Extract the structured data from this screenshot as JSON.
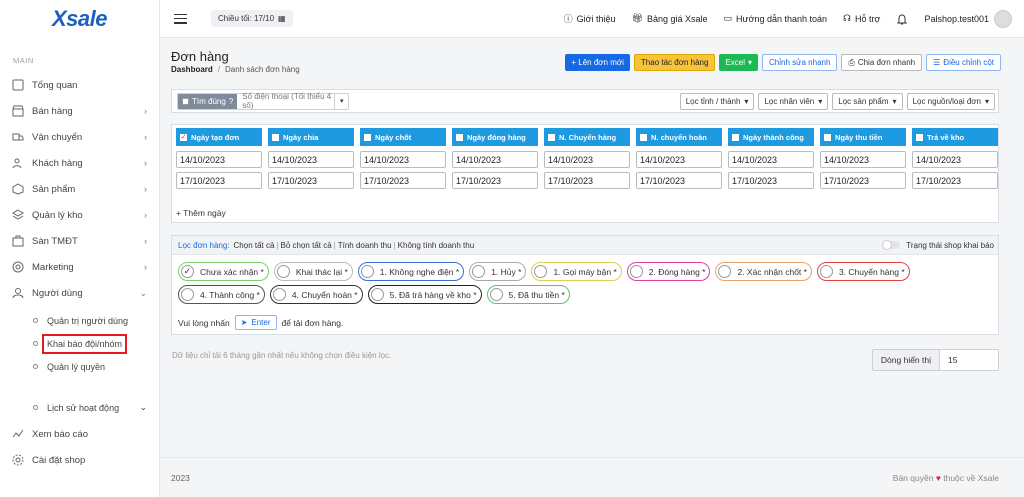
{
  "logo": "Xsale",
  "sidebar": {
    "section": "MAIN",
    "items": [
      {
        "label": "Tổng quan"
      },
      {
        "label": "Bán hàng"
      },
      {
        "label": "Vận chuyển"
      },
      {
        "label": "Khách hàng"
      },
      {
        "label": "Sản phẩm"
      },
      {
        "label": "Quản lý kho"
      },
      {
        "label": "Sàn TMĐT"
      },
      {
        "label": "Marketing"
      },
      {
        "label": "Người dùng"
      }
    ],
    "sub_items": [
      {
        "label": "Quản trị người dùng"
      },
      {
        "label": "Khai báo đội/nhóm"
      },
      {
        "label": "Quản lý quyền"
      }
    ],
    "history": "Lịch sử hoạt động",
    "reports": "Xem báo cáo",
    "shop_settings": "Cài đặt shop"
  },
  "topbar": {
    "cutoff": "Chiều tối: 17/10",
    "links": [
      "Giới thiệu",
      "Bảng giá Xsale",
      "Hướng dẫn thanh toán",
      "Hỗ trợ"
    ],
    "username": "Palshop.test001"
  },
  "page": {
    "title": "Đơn hàng",
    "breadcrumb_root": "Dashboard",
    "breadcrumb_current": "Danh sách đơn hàng"
  },
  "actions": {
    "new_order": "+ Lên đơn mới",
    "order_ops": "Thao tác đơn hàng",
    "excel": "Excel",
    "quick_edit": "Chỉnh sửa nhanh",
    "quick_split": "Chia đơn nhanh",
    "adjust_cols": "Điều chỉnh cột"
  },
  "filter": {
    "exact": "Tìm đúng",
    "phone_placeholder": "Số điện thoại (Tối thiểu 4 số)",
    "selects": [
      "Lọc tỉnh / thành",
      "Lọc nhân viên",
      "Lọc sản phẩm",
      "Lọc nguồn/loại đơn"
    ]
  },
  "dates": {
    "columns": [
      {
        "label": "Ngày tạo đơn",
        "checked": true,
        "from": "14/10/2023",
        "to": "17/10/2023"
      },
      {
        "label": "Ngày chia",
        "checked": false,
        "from": "14/10/2023",
        "to": "17/10/2023"
      },
      {
        "label": "Ngày chốt",
        "checked": false,
        "from": "14/10/2023",
        "to": "17/10/2023"
      },
      {
        "label": "Ngày đóng hàng",
        "checked": false,
        "from": "14/10/2023",
        "to": "17/10/2023"
      },
      {
        "label": "N. Chuyển hàng",
        "checked": false,
        "from": "14/10/2023",
        "to": "17/10/2023"
      },
      {
        "label": "N. chuyển hoàn",
        "checked": false,
        "from": "14/10/2023",
        "to": "17/10/2023"
      },
      {
        "label": "Ngày thành công",
        "checked": false,
        "from": "14/10/2023",
        "to": "17/10/2023"
      },
      {
        "label": "Ngày thu tiền",
        "checked": false,
        "from": "14/10/2023",
        "to": "17/10/2023"
      },
      {
        "label": "Trả về kho",
        "checked": false,
        "from": "14/10/2023",
        "to": "17/10/2023"
      }
    ],
    "add_day": "+ Thêm ngày"
  },
  "status": {
    "filter_label": "Lọc đơn hàng:",
    "select_all": "Chọn tất cả",
    "deselect_all": "Bỏ chọn tất cả",
    "calc_revenue": "Tính doanh thu",
    "no_revenue": "Không tính doanh thu",
    "toggle_label": "Trạng thái shop khai báo",
    "pills": [
      {
        "label": "Chưa xác nhận *",
        "color": "#7ccf6b",
        "checked": true
      },
      {
        "label": "Khai thác lại *",
        "color": "#bbbbbb",
        "checked": false
      },
      {
        "label": "1. Không nghe điện *",
        "color": "#3b6fd1",
        "checked": false
      },
      {
        "label": "1. Hủy *",
        "color": "#aaaaaa",
        "checked": false
      },
      {
        "label": "1. Gọi máy bận *",
        "color": "#d9d24a",
        "checked": false
      },
      {
        "label": "2. Đóng hàng *",
        "color": "#e23ca5",
        "checked": false
      },
      {
        "label": "2. Xác nhận chốt *",
        "color": "#e9a36a",
        "checked": false
      },
      {
        "label": "3. Chuyển hàng *",
        "color": "#e2443d",
        "checked": false
      },
      {
        "label": "4. Thành công *",
        "color": "#555555",
        "checked": false
      },
      {
        "label": "4. Chuyển hoàn *",
        "color": "#333333",
        "checked": false
      },
      {
        "label": "5. Đã trả hàng về kho *",
        "color": "#222222",
        "checked": false
      },
      {
        "label": "5. Đã thu tiền *",
        "color": "#5cc07a",
        "checked": false
      }
    ],
    "load_prefix": "Vui lòng nhấn",
    "enter": "Enter",
    "load_suffix": "để tải đơn hàng."
  },
  "note": "Dữ liệu chỉ tải 6 tháng gần nhất nếu không chọn điều kiện lọc.",
  "rows_label": "Dòng hiển thị",
  "rows_value": "15",
  "footer": {
    "year": "2023",
    "copyright_prefix": "Bản quyền",
    "copyright_suffix": "thuộc về Xsale"
  }
}
